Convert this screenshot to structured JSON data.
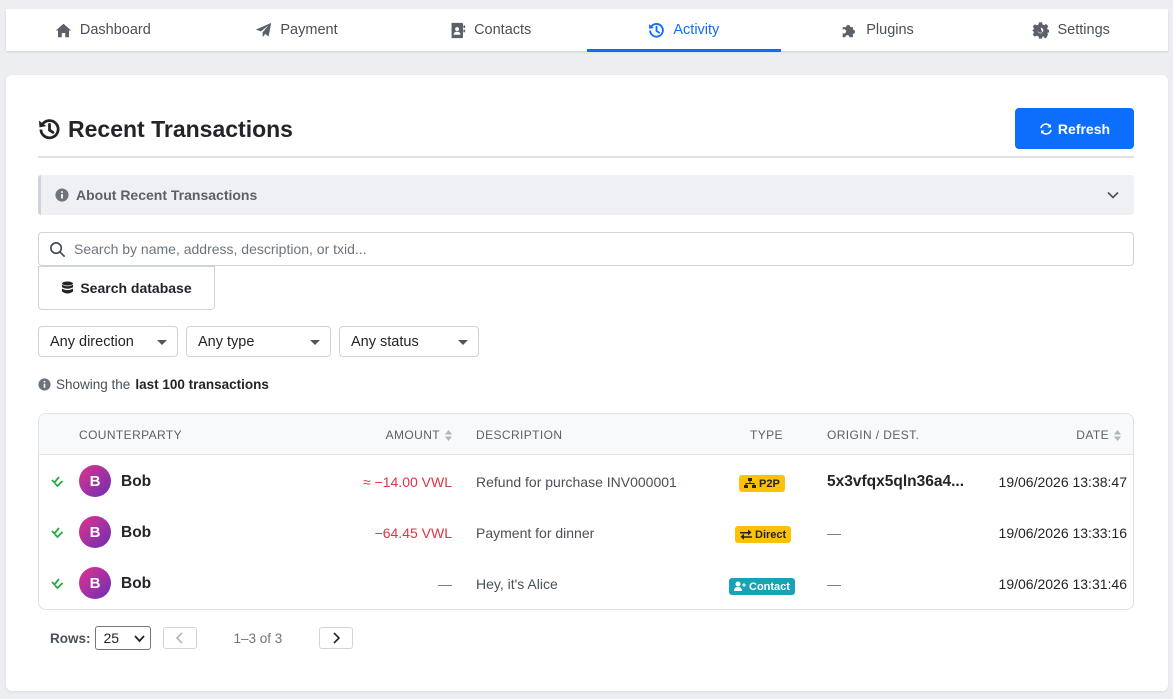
{
  "nav": {
    "tabs": [
      {
        "label": "Dashboard",
        "icon": "home-icon"
      },
      {
        "label": "Payment",
        "icon": "paper-plane-icon"
      },
      {
        "label": "Contacts",
        "icon": "address-book-icon"
      },
      {
        "label": "Activity",
        "icon": "history-icon",
        "active": true
      },
      {
        "label": "Plugins",
        "icon": "puzzle-icon"
      },
      {
        "label": "Settings",
        "icon": "gear-icon"
      }
    ]
  },
  "page": {
    "title": "Recent Transactions",
    "refresh_label": "Refresh",
    "about_label": "About Recent Transactions",
    "search_placeholder": "Search by name, address, description, or txid...",
    "search_db_label": "Search database",
    "filters": {
      "direction": "Any direction",
      "type": "Any type",
      "status": "Any status"
    },
    "showing_prefix": "Showing the",
    "showing_bold": "last 100 transactions"
  },
  "table": {
    "headers": {
      "counterparty": "COUNTERPARTY",
      "amount": "AMOUNT",
      "description": "DESCRIPTION",
      "type": "TYPE",
      "origin": "ORIGIN / DEST.",
      "date": "DATE"
    },
    "rows": [
      {
        "initial": "B",
        "name": "Bob",
        "amount": "≈ −14.00 VWL",
        "description": "Refund for purchase INV000001",
        "type": "P2P",
        "origin": "5x3vfqx5qln36a4...",
        "date": "19/06/2026 13:38:47"
      },
      {
        "initial": "B",
        "name": "Bob",
        "amount": "−64.45 VWL",
        "description": "Payment for dinner",
        "type": "Direct",
        "origin": "—",
        "date": "19/06/2026 13:33:16"
      },
      {
        "initial": "B",
        "name": "Bob",
        "amount": "—",
        "description": "Hey, it's Alice",
        "type": "Contact",
        "origin": "—",
        "date": "19/06/2026 13:31:46"
      }
    ]
  },
  "pager": {
    "rows_label": "Rows:",
    "rows_value": "25",
    "range": "1–3 of 3"
  },
  "colors": {
    "accent": "#0d6efd",
    "negative": "#dc3545",
    "success": "#28a745",
    "badge_yellow": "#ffc107",
    "badge_teal": "#17a2b8"
  }
}
